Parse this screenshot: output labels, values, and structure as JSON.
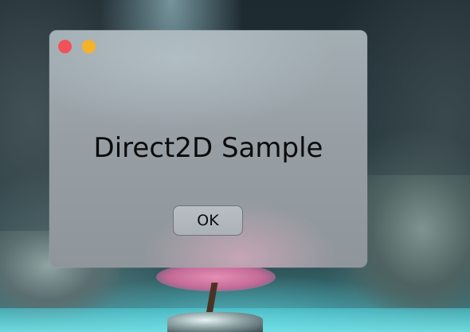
{
  "dialog": {
    "title": "Direct2D Sample",
    "ok_label": "OK"
  },
  "window_controls": {
    "close_color": "#f0525a",
    "minimize_color": "#f5b32a"
  }
}
